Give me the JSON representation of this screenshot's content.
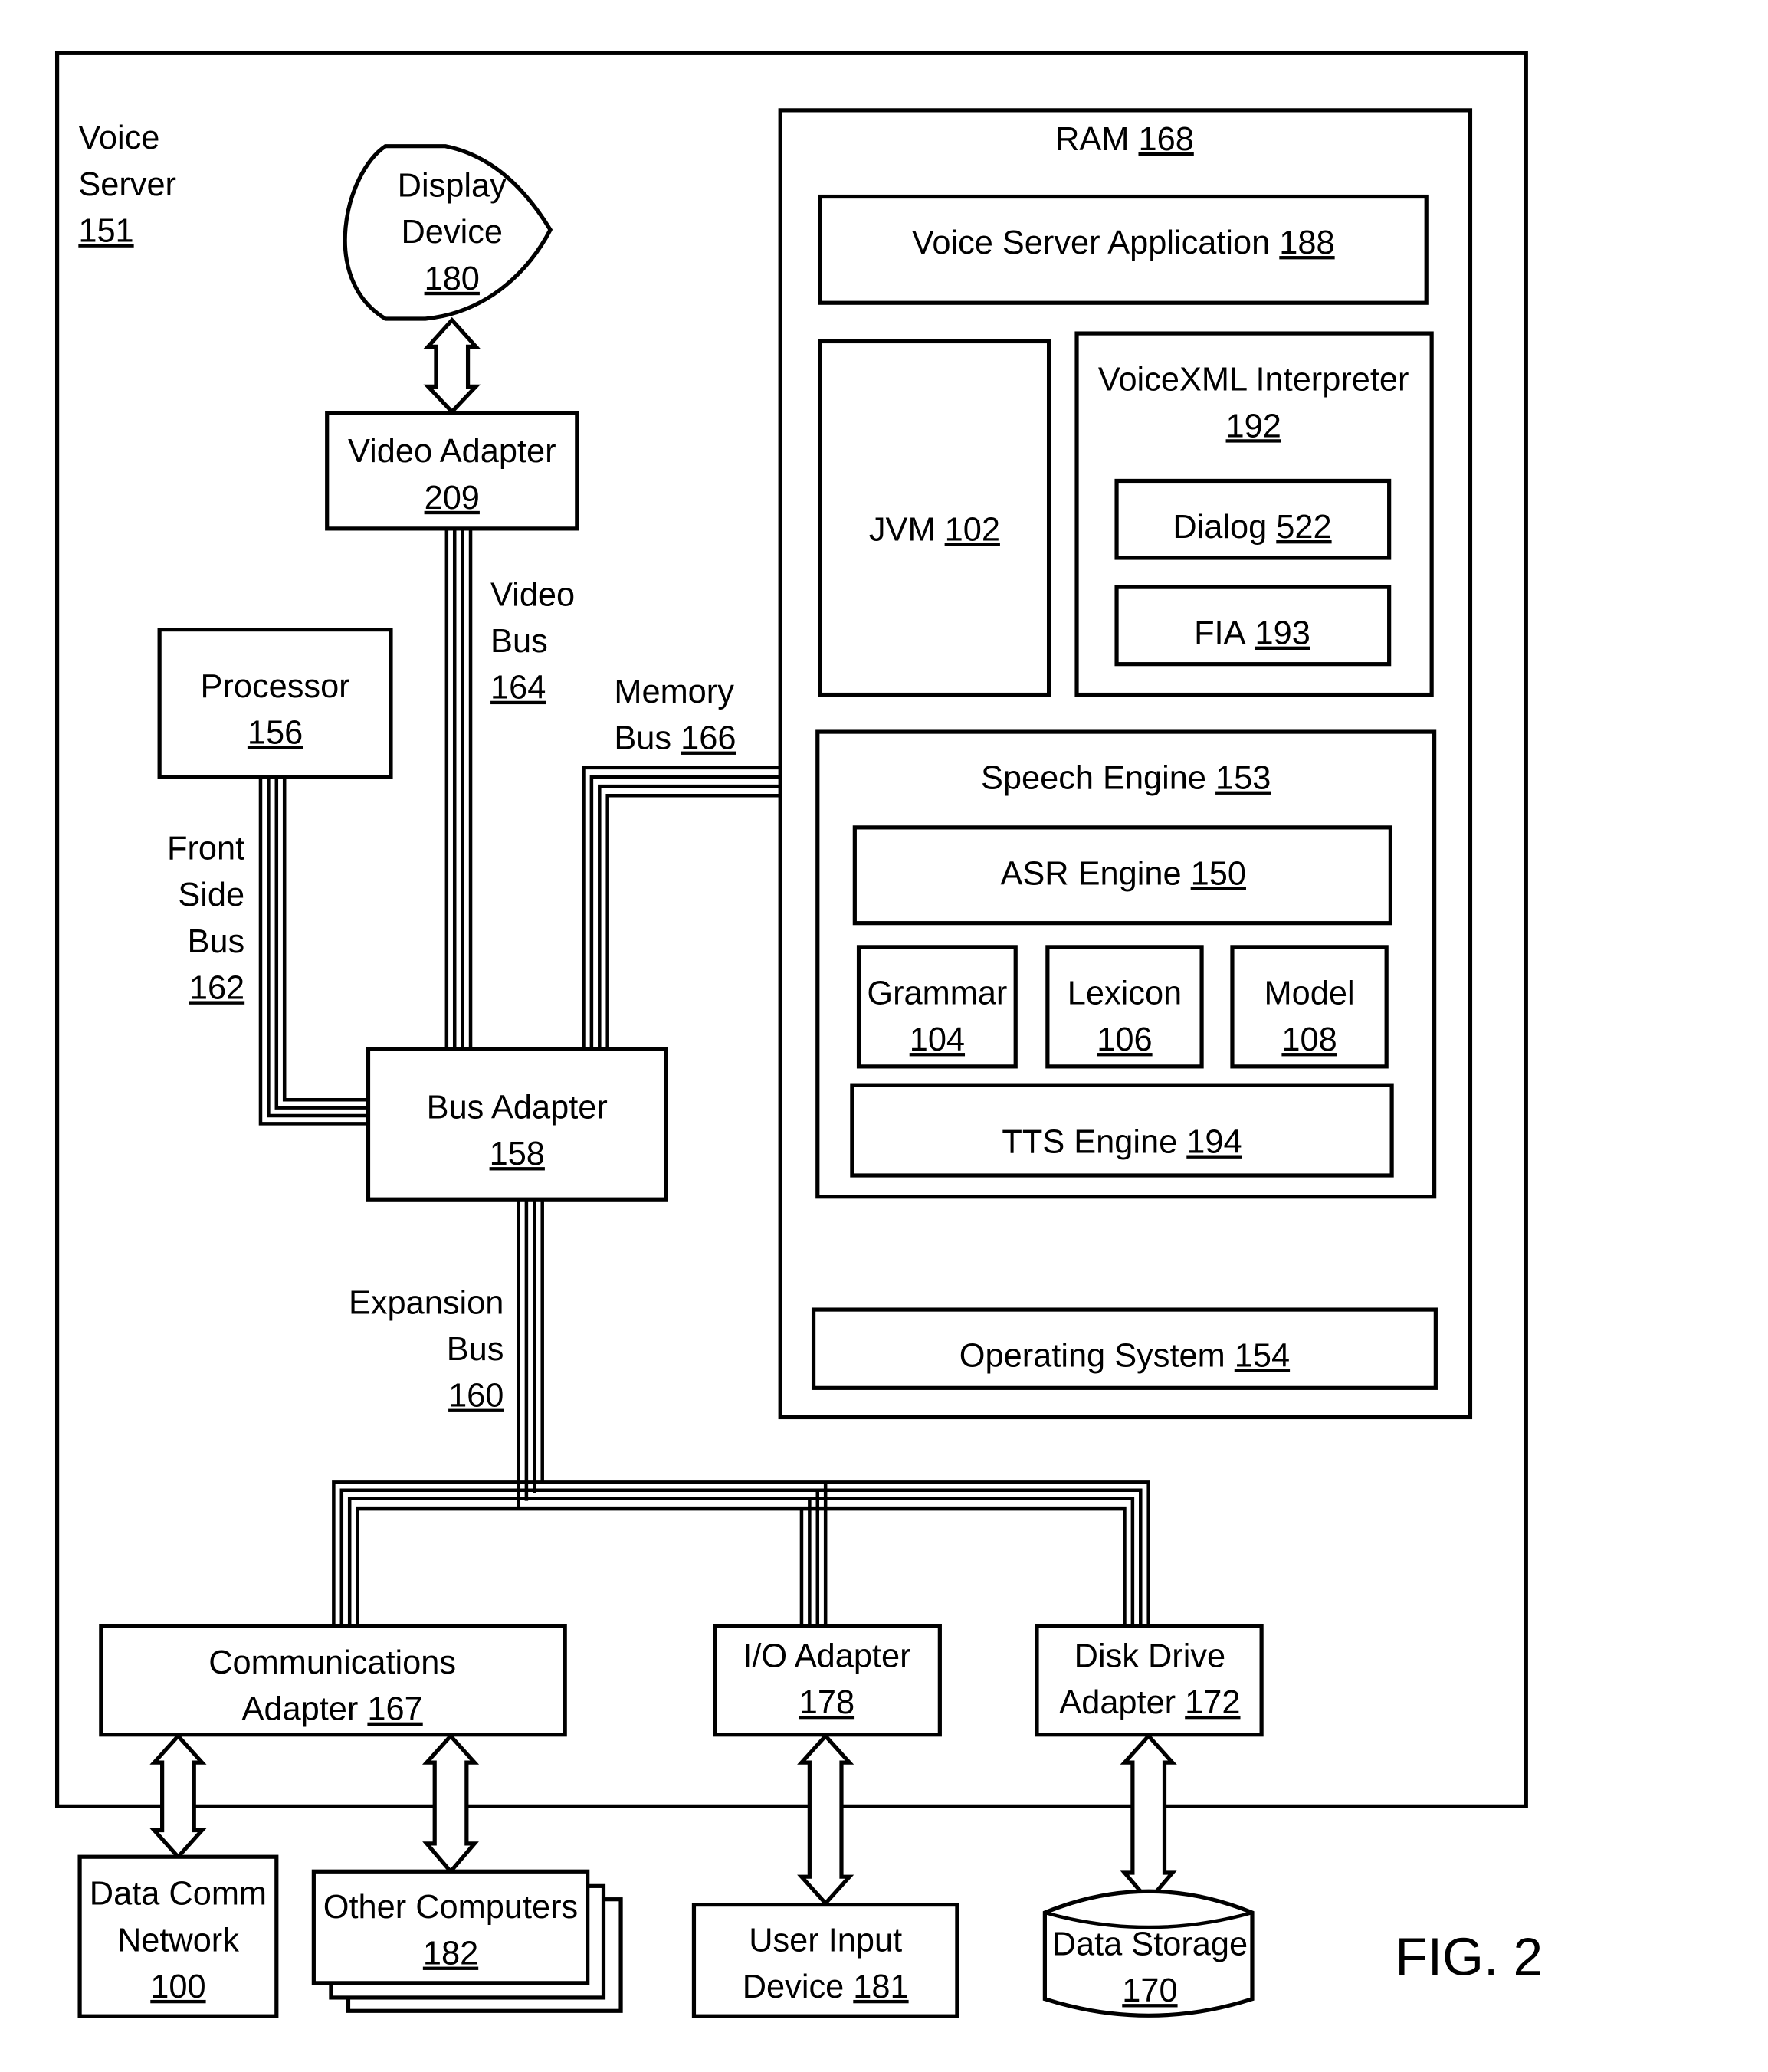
{
  "figure": {
    "label": "FIG. 2",
    "title": "Voice Server",
    "ref": "151"
  },
  "components": {
    "display_device": {
      "line1": "Display",
      "line2": "Device",
      "ref": "180"
    },
    "video_adapter": {
      "line1": "Video Adapter",
      "ref": "209"
    },
    "processor": {
      "line1": "Processor",
      "ref": "156"
    },
    "bus_adapter": {
      "line1": "Bus Adapter",
      "ref": "158"
    },
    "ram": {
      "label": "RAM",
      "ref": "168"
    },
    "voice_server_application": {
      "label": "Voice Server Application",
      "ref": "188"
    },
    "jvm": {
      "label": "JVM",
      "ref": "102"
    },
    "voicexml_interpreter": {
      "label": "VoiceXML Interpreter",
      "ref": "192"
    },
    "dialog": {
      "label": "Dialog",
      "ref": "522"
    },
    "fia": {
      "label": "FIA",
      "ref": "193"
    },
    "speech_engine": {
      "label": "Speech Engine",
      "ref": "153"
    },
    "asr_engine": {
      "label": "ASR Engine",
      "ref": "150"
    },
    "grammar": {
      "label": "Grammar",
      "ref": "104"
    },
    "lexicon": {
      "label": "Lexicon",
      "ref": "106"
    },
    "model": {
      "label": "Model",
      "ref": "108"
    },
    "tts_engine": {
      "label": "TTS Engine",
      "ref": "194"
    },
    "operating_system": {
      "label": "Operating System",
      "ref": "154"
    },
    "communications_adapter": {
      "line1": "Communications",
      "line2": "Adapter",
      "ref": "167"
    },
    "io_adapter": {
      "line1": "I/O Adapter",
      "ref": "178"
    },
    "disk_drive_adapter": {
      "line1": "Disk Drive",
      "line2": "Adapter",
      "ref": "172"
    },
    "data_comm_network": {
      "line1": "Data Comm",
      "line2": "Network",
      "ref": "100"
    },
    "other_computers": {
      "line1": "Other Computers",
      "ref": "182"
    },
    "user_input_device": {
      "line1": "User Input",
      "line2": "Device",
      "ref": "181"
    },
    "data_storage": {
      "line1": "Data Storage",
      "ref": "170"
    }
  },
  "buses": {
    "video_bus": {
      "line1": "Video",
      "line2": "Bus",
      "ref": "164"
    },
    "memory_bus": {
      "line1": "Memory",
      "line2": "Bus",
      "ref": "166"
    },
    "front_side_bus": {
      "line1": "Front",
      "line2": "Side",
      "line3": "Bus",
      "ref": "162"
    },
    "expansion_bus": {
      "line1": "Expansion",
      "line2": "Bus",
      "ref": "160"
    }
  }
}
